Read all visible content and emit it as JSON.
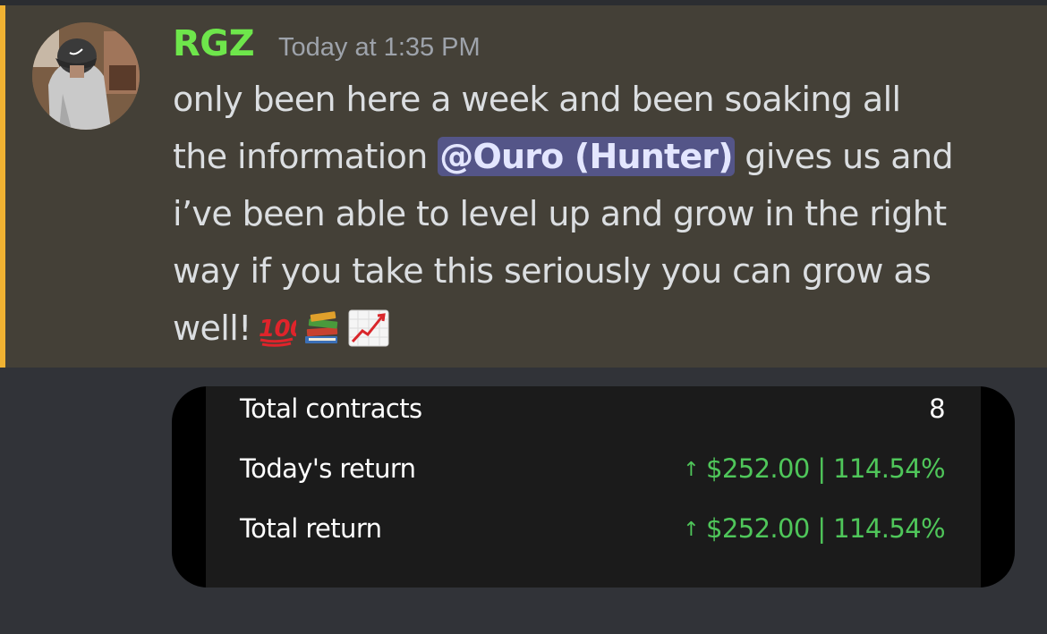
{
  "message": {
    "author": "RGZ",
    "timestamp": "Today at 1:35 PM",
    "lines": [
      "only been here a week and been soaking all",
      "the information",
      "gives us and",
      "i’ve been able to level up and grow in the right",
      "way if you take this seriously you can grow as",
      "well!"
    ],
    "mention": "@Ouro (Hunter)",
    "emojis": [
      "hundred-points-icon",
      "books-icon",
      "chart-increasing-icon"
    ],
    "colors": {
      "username": "#6ee64b",
      "mention_bg": "#545588",
      "highlight_bar": "#f0b232"
    }
  },
  "stats_card": {
    "rows": [
      {
        "label": "Total contracts",
        "value": "8",
        "arrow": ""
      },
      {
        "label": "Today's return",
        "value": "$252.00 | 114.54%",
        "arrow": "↑"
      },
      {
        "label": "Total return",
        "value": "$252.00 | 114.54%",
        "arrow": "↑"
      }
    ],
    "colors": {
      "positive": "#4fc65a"
    }
  }
}
